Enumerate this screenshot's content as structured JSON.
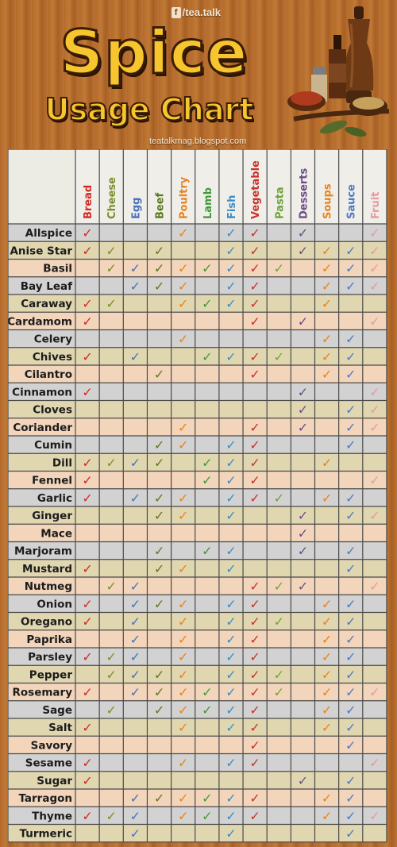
{
  "header": {
    "brand": "/tea.talk",
    "title_line1": "Spice",
    "title_line2": "Usage Chart",
    "website": "teatalkmag.blogspot.com"
  },
  "chart_data": {
    "type": "table",
    "columns": [
      {
        "label": "Bread",
        "color": "#d42a22"
      },
      {
        "label": "Cheese",
        "color": "#7b8f2b"
      },
      {
        "label": "Egg",
        "color": "#4a72b8"
      },
      {
        "label": "Beef",
        "color": "#5a7a1e"
      },
      {
        "label": "Poultry",
        "color": "#e7831f"
      },
      {
        "label": "Lamb",
        "color": "#3f9a3a"
      },
      {
        "label": "Fish",
        "color": "#3b8cc6"
      },
      {
        "label": "Vegetable",
        "color": "#c8332b"
      },
      {
        "label": "Pasta",
        "color": "#6fa33b"
      },
      {
        "label": "Desserts",
        "color": "#6d4c86"
      },
      {
        "label": "Soups",
        "color": "#e7831f"
      },
      {
        "label": "Sauce",
        "color": "#4f79c2"
      },
      {
        "label": "Fruit",
        "color": "#e49aa0"
      }
    ],
    "check_mark": "✓",
    "rows": [
      {
        "spice": "Allspice",
        "uses": [
          "Bread",
          "Poultry",
          "Fish",
          "Vegetable",
          "Desserts",
          "Fruit"
        ]
      },
      {
        "spice": "Anise Star",
        "uses": [
          "Bread",
          "Cheese",
          "Beef",
          "Fish",
          "Vegetable",
          "Desserts",
          "Soups",
          "Sauce",
          "Fruit"
        ]
      },
      {
        "spice": "Basil",
        "uses": [
          "Cheese",
          "Egg",
          "Beef",
          "Poultry",
          "Lamb",
          "Fish",
          "Vegetable",
          "Pasta",
          "Soups",
          "Sauce",
          "Fruit"
        ]
      },
      {
        "spice": "Bay Leaf",
        "uses": [
          "Egg",
          "Beef",
          "Poultry",
          "Fish",
          "Vegetable",
          "Soups",
          "Sauce",
          "Fruit"
        ]
      },
      {
        "spice": "Caraway",
        "uses": [
          "Bread",
          "Cheese",
          "Poultry",
          "Lamb",
          "Fish",
          "Vegetable",
          "Soups"
        ]
      },
      {
        "spice": "Cardamom",
        "uses": [
          "Bread",
          "Vegetable",
          "Desserts",
          "Fruit"
        ]
      },
      {
        "spice": "Celery",
        "uses": [
          "Poultry",
          "Soups",
          "Sauce"
        ]
      },
      {
        "spice": "Chives",
        "uses": [
          "Bread",
          "Egg",
          "Lamb",
          "Fish",
          "Vegetable",
          "Pasta",
          "Soups",
          "Sauce"
        ]
      },
      {
        "spice": "Cilantro",
        "uses": [
          "Beef",
          "Vegetable",
          "Soups",
          "Sauce"
        ]
      },
      {
        "spice": "Cinnamon",
        "uses": [
          "Bread",
          "Desserts",
          "Fruit"
        ]
      },
      {
        "spice": "Cloves",
        "uses": [
          "Desserts",
          "Sauce",
          "Fruit"
        ]
      },
      {
        "spice": "Coriander",
        "uses": [
          "Poultry",
          "Vegetable",
          "Desserts",
          "Sauce",
          "Fruit"
        ]
      },
      {
        "spice": "Cumin",
        "uses": [
          "Beef",
          "Poultry",
          "Fish",
          "Vegetable",
          "Sauce"
        ]
      },
      {
        "spice": "Dill",
        "uses": [
          "Bread",
          "Cheese",
          "Egg",
          "Beef",
          "Lamb",
          "Fish",
          "Vegetable",
          "Soups"
        ]
      },
      {
        "spice": "Fennel",
        "uses": [
          "Bread",
          "Lamb",
          "Fish",
          "Vegetable",
          "Fruit"
        ]
      },
      {
        "spice": "Garlic",
        "uses": [
          "Bread",
          "Egg",
          "Beef",
          "Poultry",
          "Fish",
          "Vegetable",
          "Pasta",
          "Soups",
          "Sauce"
        ]
      },
      {
        "spice": "Ginger",
        "uses": [
          "Beef",
          "Poultry",
          "Fish",
          "Desserts",
          "Sauce",
          "Fruit"
        ]
      },
      {
        "spice": "Mace",
        "uses": [
          "Desserts"
        ]
      },
      {
        "spice": "Marjoram",
        "uses": [
          "Beef",
          "Lamb",
          "Fish",
          "Desserts",
          "Sauce"
        ]
      },
      {
        "spice": "Mustard",
        "uses": [
          "Bread",
          "Beef",
          "Poultry",
          "Fish",
          "Sauce"
        ]
      },
      {
        "spice": "Nutmeg",
        "uses": [
          "Cheese",
          "Egg",
          "Vegetable",
          "Pasta",
          "Desserts",
          "Fruit"
        ]
      },
      {
        "spice": "Onion",
        "uses": [
          "Bread",
          "Egg",
          "Beef",
          "Poultry",
          "Fish",
          "Vegetable",
          "Soups",
          "Sauce"
        ]
      },
      {
        "spice": "Oregano",
        "uses": [
          "Bread",
          "Egg",
          "Poultry",
          "Fish",
          "Vegetable",
          "Pasta",
          "Soups",
          "Sauce"
        ]
      },
      {
        "spice": "Paprika",
        "uses": [
          "Egg",
          "Poultry",
          "Fish",
          "Vegetable",
          "Soups",
          "Sauce"
        ]
      },
      {
        "spice": "Parsley",
        "uses": [
          "Bread",
          "Cheese",
          "Egg",
          "Poultry",
          "Fish",
          "Vegetable",
          "Soups",
          "Sauce"
        ]
      },
      {
        "spice": "Pepper",
        "uses": [
          "Cheese",
          "Egg",
          "Beef",
          "Poultry",
          "Fish",
          "Vegetable",
          "Pasta",
          "Soups",
          "Sauce"
        ]
      },
      {
        "spice": "Rosemary",
        "uses": [
          "Bread",
          "Egg",
          "Beef",
          "Poultry",
          "Lamb",
          "Fish",
          "Vegetable",
          "Pasta",
          "Soups",
          "Sauce",
          "Fruit"
        ]
      },
      {
        "spice": "Sage",
        "uses": [
          "Cheese",
          "Beef",
          "Poultry",
          "Lamb",
          "Fish",
          "Vegetable",
          "Soups",
          "Sauce"
        ]
      },
      {
        "spice": "Salt",
        "uses": [
          "Bread",
          "Poultry",
          "Fish",
          "Vegetable",
          "Soups",
          "Sauce"
        ]
      },
      {
        "spice": "Savory",
        "uses": [
          "Vegetable",
          "Sauce"
        ]
      },
      {
        "spice": "Sesame",
        "uses": [
          "Bread",
          "Poultry",
          "Fish",
          "Vegetable",
          "Fruit"
        ]
      },
      {
        "spice": "Sugar",
        "uses": [
          "Bread",
          "Desserts",
          "Sauce"
        ]
      },
      {
        "spice": "Tarragon",
        "uses": [
          "Egg",
          "Beef",
          "Poultry",
          "Lamb",
          "Fish",
          "Vegetable",
          "Soups",
          "Sauce"
        ]
      },
      {
        "spice": "Thyme",
        "uses": [
          "Bread",
          "Cheese",
          "Egg",
          "Poultry",
          "Lamb",
          "Fish",
          "Vegetable",
          "Soups",
          "Sauce",
          "Fruit"
        ]
      },
      {
        "spice": "Turmeric",
        "uses": [
          "Egg",
          "Fish",
          "Sauce"
        ]
      }
    ]
  }
}
